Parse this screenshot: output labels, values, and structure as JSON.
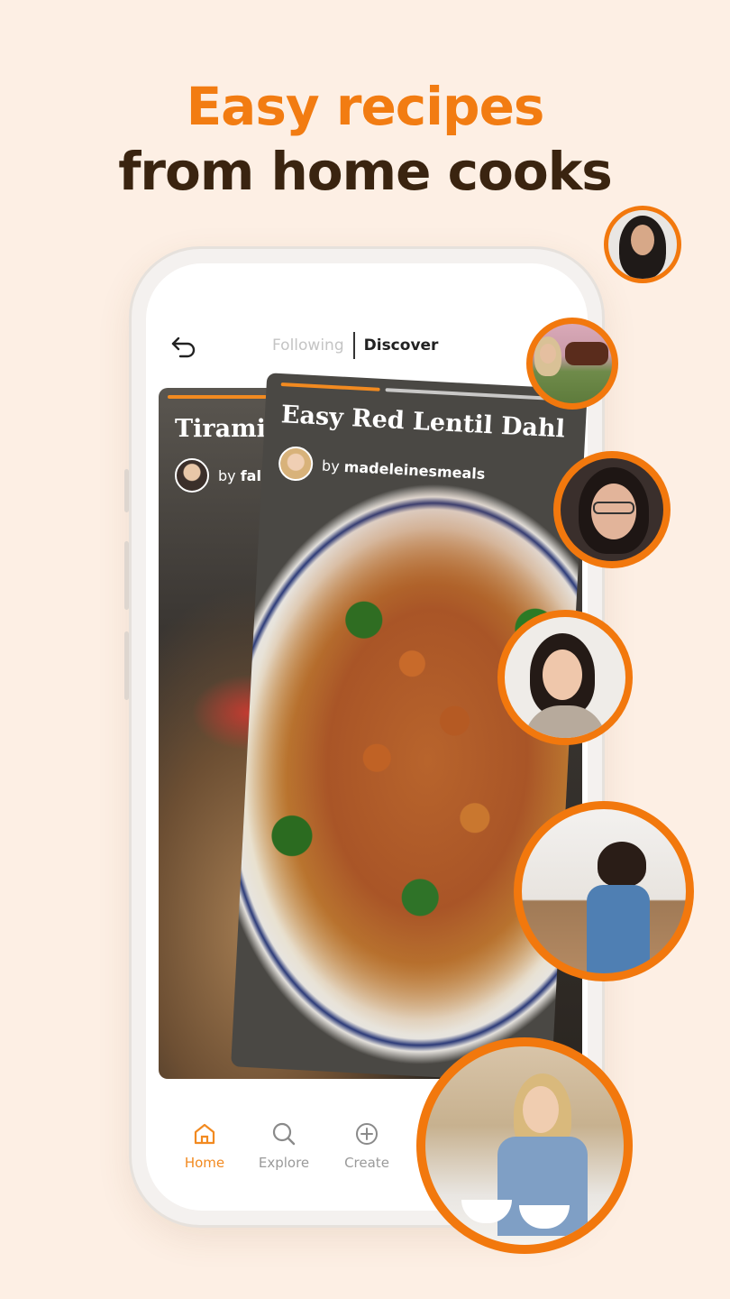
{
  "headline": {
    "line1": "Easy recipes",
    "line2": "from home cooks"
  },
  "tabs": {
    "following": "Following",
    "discover": "Discover"
  },
  "cards": {
    "back": {
      "title": "Tiramisu",
      "by": "by",
      "author": "fala"
    },
    "front": {
      "title": "Easy Red Lentil Dahl",
      "by": "by",
      "author": "madeleinesmeals"
    }
  },
  "nav": {
    "home": "Home",
    "explore": "Explore",
    "create": "Create"
  },
  "colors": {
    "accent": "#f2780d",
    "headline_orange": "#f27c12",
    "headline_dark": "#3a2410",
    "background": "#fdefe4"
  },
  "icons": [
    "back-arrow-icon",
    "home-icon",
    "search-icon",
    "plus-circle-icon"
  ]
}
